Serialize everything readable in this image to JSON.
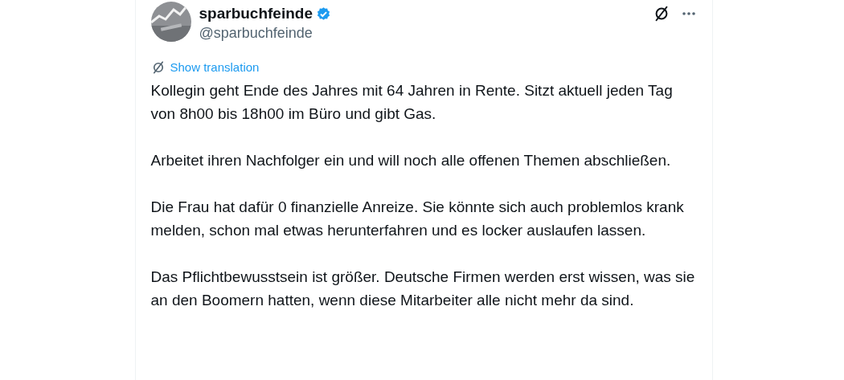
{
  "author": {
    "name": "sparbuchfeinde",
    "verified": true,
    "handle": "@sparbuchfeinde"
  },
  "translate_link": "Show translation",
  "paragraphs": [
    "Kollegin geht Ende des Jahres mit 64 Jahren in Rente. Sitzt aktuell jeden Tag von 8h00 bis 18h00 im Büro und gibt Gas.",
    "Arbeitet ihren Nachfolger ein und will noch alle offenen Themen abschließen.",
    "Die Frau hat dafür 0 finanzielle Anreize. Sie könnte sich auch problemlos krank melden, schon mal etwas herunterfahren und es locker auslaufen lassen.",
    "Das Pflichtbewusstsein ist größer. Deutsche Firmen werden erst wissen, was sie an den Boomern hatten, wenn diese Mitarbeiter alle nicht mehr da sind."
  ]
}
